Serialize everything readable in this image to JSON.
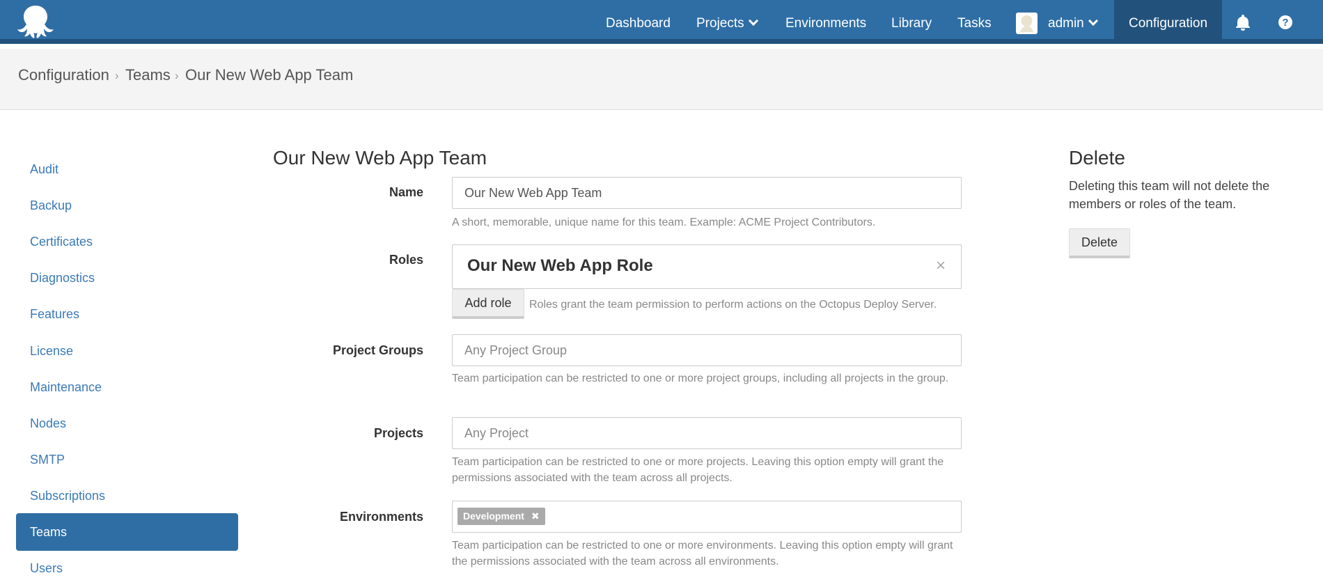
{
  "nav": {
    "dashboard": "Dashboard",
    "projects": "Projects",
    "environments": "Environments",
    "library": "Library",
    "tasks": "Tasks",
    "user": "admin",
    "configuration": "Configuration",
    "icons": [
      "octopus-logo-icon",
      "bell-icon",
      "help-icon",
      "chevron-down-icon"
    ]
  },
  "breadcrumb": {
    "items": [
      "Configuration",
      "Teams",
      "Our New Web App Team"
    ],
    "separator": "›"
  },
  "sidebar": {
    "items": [
      {
        "label": "Audit"
      },
      {
        "label": "Backup"
      },
      {
        "label": "Certificates"
      },
      {
        "label": "Diagnostics"
      },
      {
        "label": "Features"
      },
      {
        "label": "License"
      },
      {
        "label": "Maintenance"
      },
      {
        "label": "Nodes"
      },
      {
        "label": "SMTP"
      },
      {
        "label": "Subscriptions"
      },
      {
        "label": "Teams",
        "active": true
      },
      {
        "label": "Users"
      }
    ]
  },
  "form": {
    "title": "Our New Web App Team",
    "name": {
      "label": "Name",
      "value": "Our New Web App Team",
      "help": "A short, memorable, unique name for this team. Example: ACME Project Contributors."
    },
    "roles": {
      "label": "Roles",
      "role_name": "Our New Web App Role",
      "remove_glyph": "×",
      "add_button": "Add role",
      "help": "Roles grant the team permission to perform actions on the Octopus Deploy Server."
    },
    "project_groups": {
      "label": "Project Groups",
      "placeholder": "Any Project Group",
      "help": "Team participation can be restricted to one or more project groups, including all projects in the group."
    },
    "projects": {
      "label": "Projects",
      "placeholder": "Any Project",
      "help": "Team participation can be restricted to one or more projects. Leaving this option empty will grant the permissions associated with the team across all projects."
    },
    "environments": {
      "label": "Environments",
      "tag": "Development",
      "tag_remove": "✖",
      "help": "Team participation can be restricted to one or more environments. Leaving this option empty will grant the permissions associated with the team across all environments."
    }
  },
  "delete_panel": {
    "title": "Delete",
    "text": "Deleting this team will not delete the members or roles of the team.",
    "button": "Delete"
  },
  "colors": {
    "brand": "#2f6ea5",
    "brand_dark": "#22527c",
    "link": "#3a7ab7"
  }
}
